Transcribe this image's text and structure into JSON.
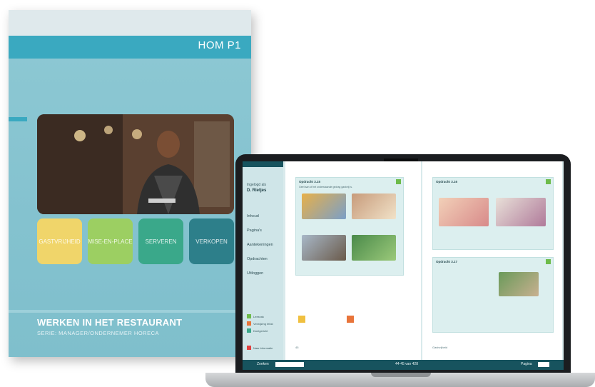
{
  "book": {
    "code": "HOM P1",
    "title": "WERKEN IN HET RESTAURANT",
    "subtitle": "SERIE: MANAGER/ONDERNEMER HORECA",
    "tiles": [
      {
        "label": "GASTVRIJHEID",
        "color": "#f0d56a"
      },
      {
        "label": "MISE-EN-PLACE",
        "color": "#9ccf62"
      },
      {
        "label": "SERVEREN",
        "color": "#3aa88a"
      },
      {
        "label": "VERKOPEN",
        "color": "#2d7f8a"
      }
    ]
  },
  "app": {
    "sidebar": {
      "login_label": "Ingelogd als",
      "user_name": "D. Rietjes",
      "items": [
        "Inhoud",
        "Pagina's",
        "Aantekeningen",
        "Opdrachten",
        "Uitloggen"
      ],
      "legend": [
        {
          "label": "Leesvak",
          "color": "#6dbb4a"
        },
        {
          "label": "Verwijzing tekst",
          "color": "#e8743a"
        },
        {
          "label": "Doelgericht",
          "color": "#3aa88a"
        }
      ],
      "extra_label": "Naar informatie"
    },
    "left_page": {
      "card1_title": "Opdracht 3.15",
      "card1_desc": "Geef aan of het onderstaande gedrag gastvrij is.",
      "footer_left": "45"
    },
    "right_page": {
      "card1_title": "Opdracht 3.16",
      "card2_title": "Opdracht 3.17",
      "footer_right": "Gastvrijheid"
    },
    "bottom_bar": {
      "zoom_label": "Zoeken",
      "page_info": "44-45 van 428",
      "page_label": "Pagina"
    }
  }
}
